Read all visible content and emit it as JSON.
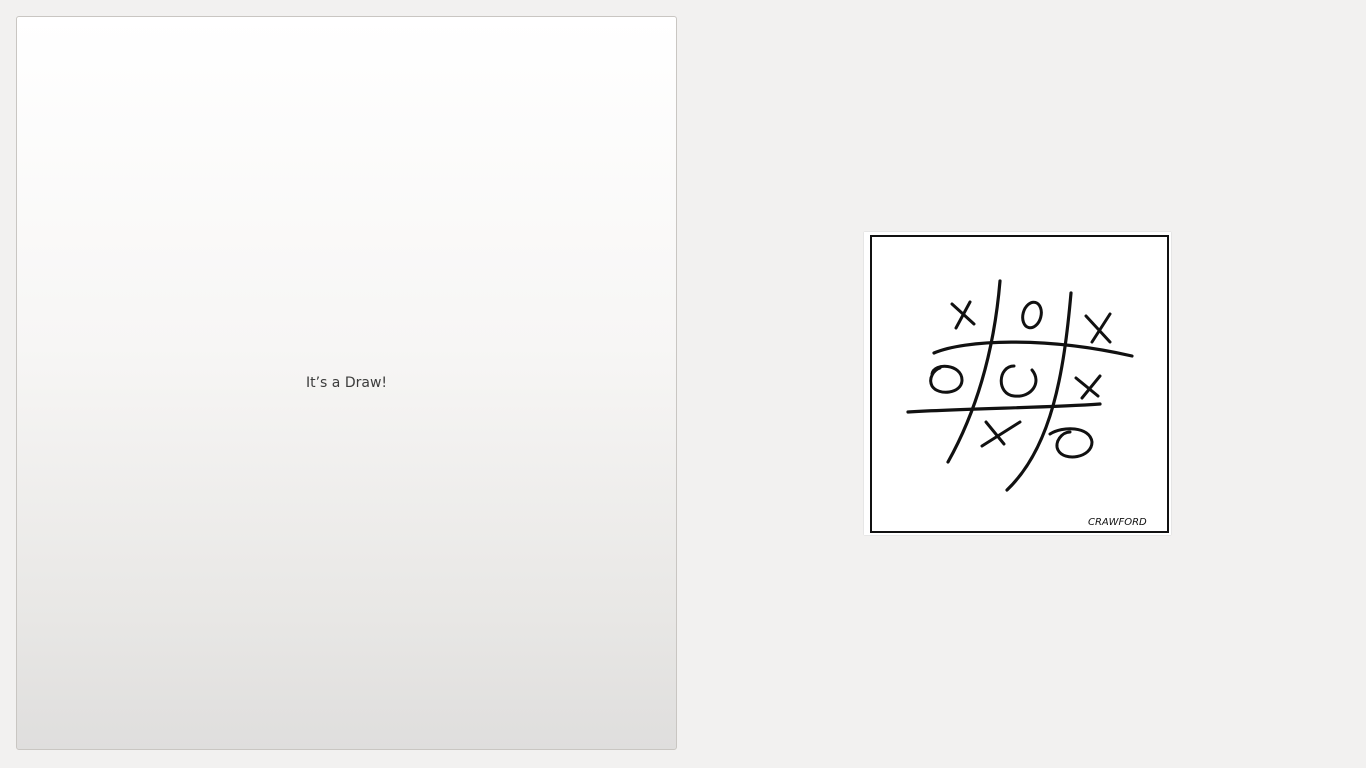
{
  "result": {
    "message": "It’s a Draw!"
  },
  "cartoon": {
    "signature": "CRAWFORD",
    "board": [
      [
        "X",
        "O",
        "X"
      ],
      [
        "O",
        "O",
        "X"
      ],
      [
        "",
        "X",
        "O"
      ]
    ]
  }
}
